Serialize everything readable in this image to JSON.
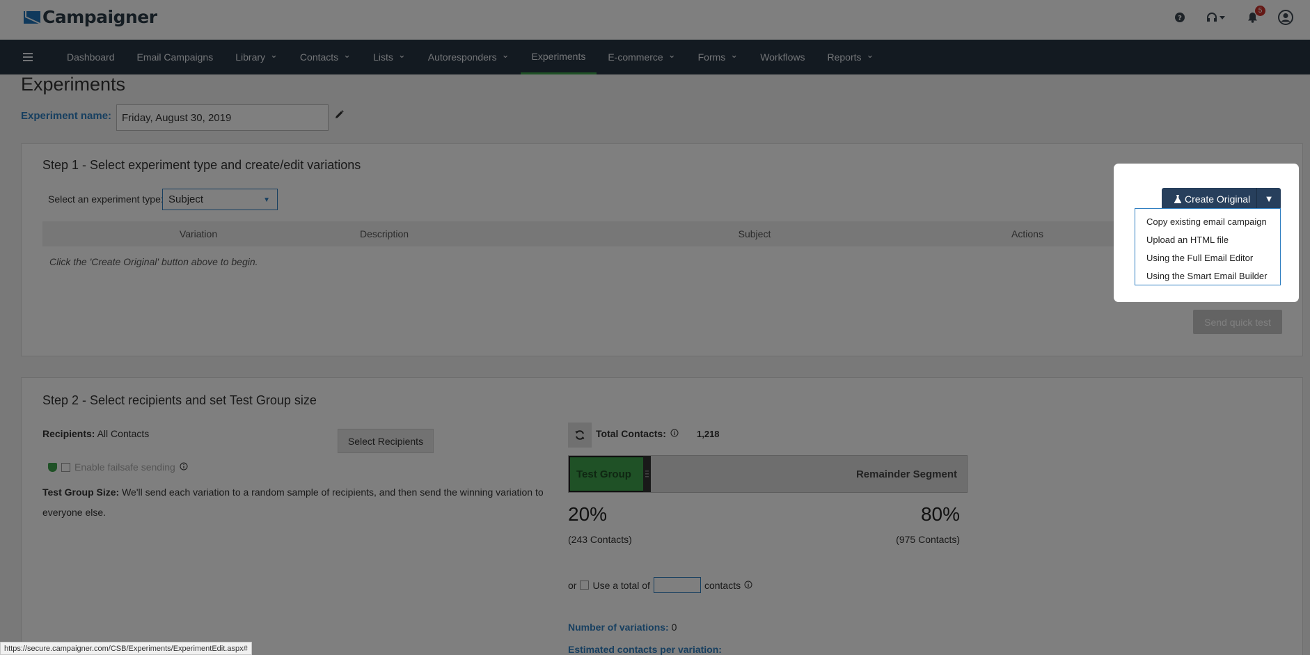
{
  "app": {
    "brand": "Campaigner"
  },
  "header": {
    "notification_count": "5"
  },
  "nav": {
    "items": [
      {
        "label": "Dashboard",
        "dropdown": false
      },
      {
        "label": "Email Campaigns",
        "dropdown": false
      },
      {
        "label": "Library",
        "dropdown": true
      },
      {
        "label": "Contacts",
        "dropdown": true
      },
      {
        "label": "Lists",
        "dropdown": true
      },
      {
        "label": "Autoresponders",
        "dropdown": true
      },
      {
        "label": "Experiments",
        "dropdown": false,
        "active": true
      },
      {
        "label": "E-commerce",
        "dropdown": true
      },
      {
        "label": "Forms",
        "dropdown": true
      },
      {
        "label": "Workflows",
        "dropdown": false
      },
      {
        "label": "Reports",
        "dropdown": true
      }
    ]
  },
  "page": {
    "title": "Experiments",
    "experiment_name_label": "Experiment name:",
    "experiment_name_value": "Friday, August 30, 2019"
  },
  "step1": {
    "title": "Step 1 - Select experiment type and create/edit variations",
    "type_label": "Select an experiment type:",
    "type_value": "Subject",
    "columns": [
      "Variation",
      "Description",
      "Subject",
      "Actions"
    ],
    "empty_message": "Click the 'Create Original' button above to begin.",
    "send_quick_test": "Send quick test"
  },
  "step2": {
    "title": "Step 2 - Select recipients and set Test Group size",
    "recipients_label": "Recipients:",
    "recipients_value": "All Contacts",
    "select_recipients": "Select Recipients",
    "failsafe_label": "Enable failsafe sending",
    "test_group_size_label": "Test Group Size:",
    "test_group_size_text": "We'll send each variation to a random sample of recipients, and then send the winning variation to everyone else.",
    "total_contacts_label": "Total Contacts:",
    "total_contacts_value": "1,218",
    "test_group_label": "Test Group",
    "remainder_label": "Remainder Segment",
    "test_group_percent": "20%",
    "remainder_percent": "80%",
    "test_group_share": 0.2,
    "test_group_contacts": "(243 Contacts)",
    "remainder_contacts": "(975 Contacts)",
    "or_label": "or",
    "use_total_label": "Use a total of",
    "contacts_label": "contacts",
    "num_variations_label": "Number of variations:",
    "num_variations_value": "0",
    "estimated_label": "Estimated contacts per variation:"
  },
  "popup": {
    "create_original": "Create Original",
    "menu": [
      "Copy existing email campaign",
      "Upload an HTML file",
      "Using the Full Email Editor",
      "Using the Smart Email Builder"
    ]
  },
  "statusbar": {
    "url": "https://secure.campaigner.com/CSB/Experiments/ExperimentEdit.aspx#"
  }
}
